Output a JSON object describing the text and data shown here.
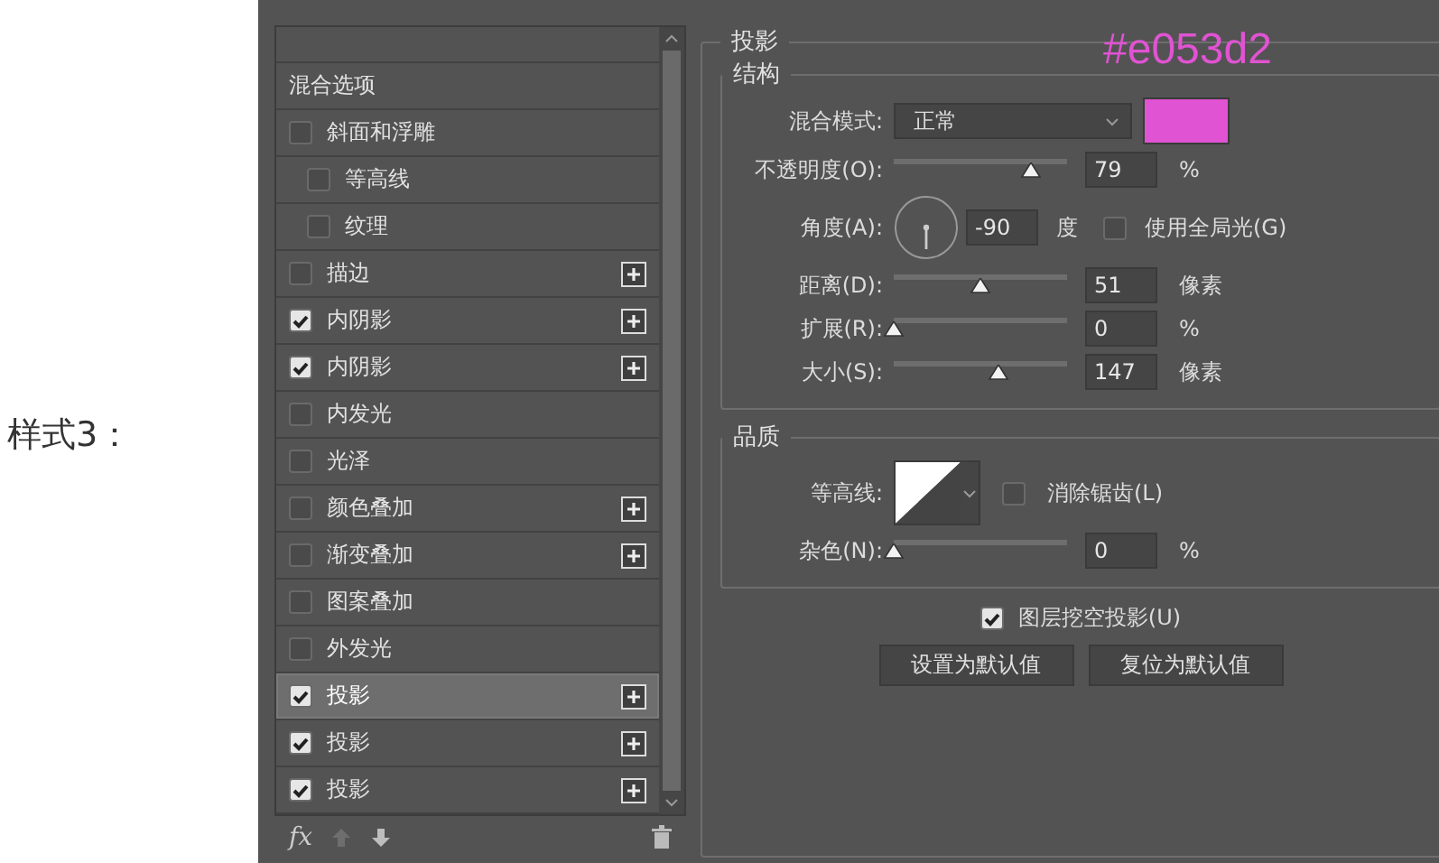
{
  "side_label": "样式3：",
  "annotation": "#e053d2",
  "style_list": {
    "items": [
      {
        "kind": "option",
        "label": "混合选项",
        "selected": false
      },
      {
        "kind": "effect",
        "label": "斜面和浮雕",
        "checked": false,
        "addable": false,
        "selected": false,
        "children": [
          {
            "kind": "effect",
            "label": "等高线",
            "checked": false,
            "addable": false,
            "selected": false
          },
          {
            "kind": "effect",
            "label": "纹理",
            "checked": false,
            "addable": false,
            "selected": false
          }
        ]
      },
      {
        "kind": "effect",
        "label": "描边",
        "checked": false,
        "addable": true,
        "selected": false
      },
      {
        "kind": "effect",
        "label": "内阴影",
        "checked": true,
        "addable": true,
        "selected": false
      },
      {
        "kind": "effect",
        "label": "内阴影",
        "checked": true,
        "addable": true,
        "selected": false
      },
      {
        "kind": "effect",
        "label": "内发光",
        "checked": false,
        "addable": false,
        "selected": false
      },
      {
        "kind": "effect",
        "label": "光泽",
        "checked": false,
        "addable": false,
        "selected": false
      },
      {
        "kind": "effect",
        "label": "颜色叠加",
        "checked": false,
        "addable": true,
        "selected": false
      },
      {
        "kind": "effect",
        "label": "渐变叠加",
        "checked": false,
        "addable": true,
        "selected": false
      },
      {
        "kind": "effect",
        "label": "图案叠加",
        "checked": false,
        "addable": false,
        "selected": false
      },
      {
        "kind": "effect",
        "label": "外发光",
        "checked": false,
        "addable": false,
        "selected": false
      },
      {
        "kind": "effect",
        "label": "投影",
        "checked": true,
        "addable": true,
        "selected": true
      },
      {
        "kind": "effect",
        "label": "投影",
        "checked": true,
        "addable": true,
        "selected": false
      },
      {
        "kind": "effect",
        "label": "投影",
        "checked": true,
        "addable": true,
        "selected": false
      }
    ],
    "toolbar": {
      "fx": "fx"
    }
  },
  "section_title": "投影",
  "structure": {
    "title": "结构",
    "blend_mode": {
      "label": "混合模式:",
      "value": "正常"
    },
    "opacity": {
      "label": "不透明度(O):",
      "value": "79",
      "unit": "%",
      "level": 0.79
    },
    "angle": {
      "label": "角度(A):",
      "value": "-90",
      "unit": "度",
      "global_light": {
        "label": "使用全局光(G)",
        "checked": false
      }
    },
    "sliders": [
      {
        "label": "距离(D):",
        "value": "51",
        "unit": "像素",
        "level": 0.5
      },
      {
        "label": "扩展(R):",
        "value": "0",
        "unit": "%",
        "level": 0
      },
      {
        "label": "大小(S):",
        "value": "147",
        "unit": "像素",
        "level": 0.6
      }
    ]
  },
  "quality": {
    "title": "品质",
    "contour": {
      "label": "等高线:",
      "anti_alias": {
        "label": "消除锯齿(L)",
        "checked": false
      }
    },
    "noise": {
      "label": "杂色(N):",
      "value": "0",
      "unit": "%",
      "level": 0
    }
  },
  "knockout": {
    "label": "图层挖空投影(U)",
    "checked": true
  },
  "buttons": [
    "设置为默认值",
    "复位为默认值"
  ]
}
